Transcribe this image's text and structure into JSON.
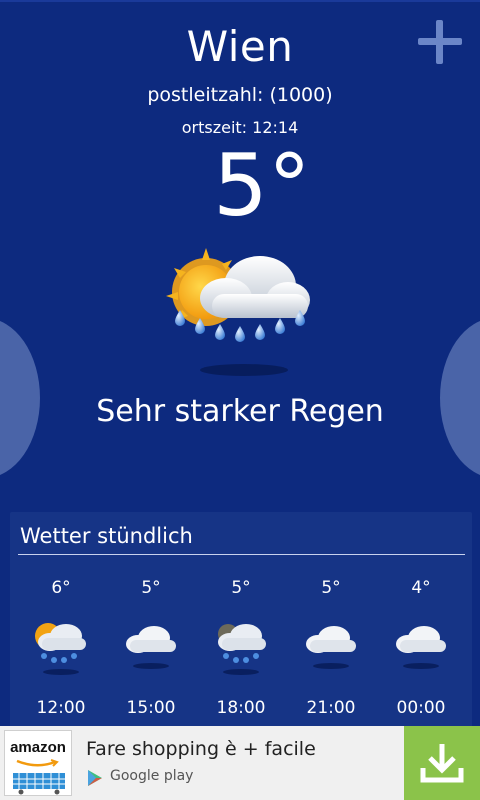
{
  "header": {
    "city": "Wien",
    "zip_label": "postleitzahl: (1000)",
    "local_time_label": "ortszeit: 12:14",
    "temperature": "5°",
    "condition": "Sehr starker Regen",
    "main_icon": "sun-cloud-heavy-rain-icon"
  },
  "hourly": {
    "title": "Wetter stündlich",
    "items": [
      {
        "temp": "6°",
        "time": "12:00",
        "icon": "sun-cloud-rain-icon"
      },
      {
        "temp": "5°",
        "time": "15:00",
        "icon": "cloud-icon"
      },
      {
        "temp": "5°",
        "time": "18:00",
        "icon": "cloud-rain-icon"
      },
      {
        "temp": "5°",
        "time": "21:00",
        "icon": "cloud-icon"
      },
      {
        "temp": "4°",
        "time": "00:00",
        "icon": "cloud-icon"
      }
    ]
  },
  "ad": {
    "brand": "amazon",
    "text": "Fare shopping è + facile",
    "store": "Google play"
  },
  "colors": {
    "background": "#0d2a7f",
    "panel": "#163486",
    "nav_circle": "#4a64a8",
    "add_icon": "#6b86c8",
    "download_button": "#8bc34a"
  }
}
